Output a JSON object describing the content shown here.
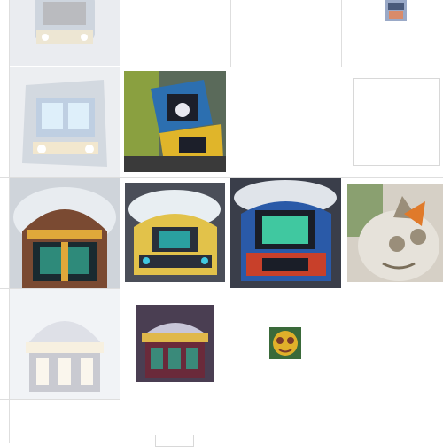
{
  "grid": {
    "line_color": "#dedede",
    "background": "#ffffff"
  },
  "tiles": [
    {
      "id": "r0c0",
      "subject": "train-front-faded",
      "faded": true,
      "palette": [
        "#6a7f9a",
        "#c9b27a",
        "#2c2f3a"
      ]
    },
    {
      "id": "r0c3",
      "subject": "small-thumbnail",
      "faded": false,
      "palette": [
        "#9aa9c7",
        "#d98b6a",
        "#4a5a7a"
      ]
    },
    {
      "id": "r1c0",
      "subject": "train-cab-faded",
      "faded": true,
      "palette": [
        "#3a6ea8",
        "#d7b86a",
        "#222a36"
      ]
    },
    {
      "id": "r1c1",
      "subject": "yellow-locomotive",
      "faded": false,
      "palette": [
        "#e0b52a",
        "#2c6fb0",
        "#1c1f2a"
      ]
    },
    {
      "id": "r1c3",
      "subject": "empty-frame",
      "faded": false,
      "palette": []
    },
    {
      "id": "r2c0",
      "subject": "train-dome-front",
      "faded": false,
      "palette": [
        "#2e8a7a",
        "#e0a83a",
        "#7a4a32"
      ]
    },
    {
      "id": "r2c1",
      "subject": "yellow-train-front",
      "faded": false,
      "palette": [
        "#e2c24a",
        "#2aa0a0",
        "#2a2f3a"
      ]
    },
    {
      "id": "r2c2",
      "subject": "red-blue-train-front",
      "faded": false,
      "palette": [
        "#c8402a",
        "#2a5aa8",
        "#40c8a0"
      ]
    },
    {
      "id": "r2c3",
      "subject": "cat-face",
      "faded": false,
      "palette": [
        "#d6d0c6",
        "#9a8e7a",
        "#e07a2a"
      ]
    },
    {
      "id": "r3c0",
      "subject": "dome-building-faded",
      "faded": true,
      "palette": [
        "#9aa0b8",
        "#e8d2a0",
        "#5a5e72"
      ]
    },
    {
      "id": "r3c1",
      "subject": "train-station-front",
      "faded": false,
      "palette": [
        "#3a8a7a",
        "#e0b84a",
        "#6a2a3a"
      ]
    },
    {
      "id": "r3c2",
      "subject": "tiny-face",
      "faded": false,
      "palette": [
        "#e0b02a",
        "#3a6a3a",
        "#7a3a2a"
      ]
    }
  ]
}
